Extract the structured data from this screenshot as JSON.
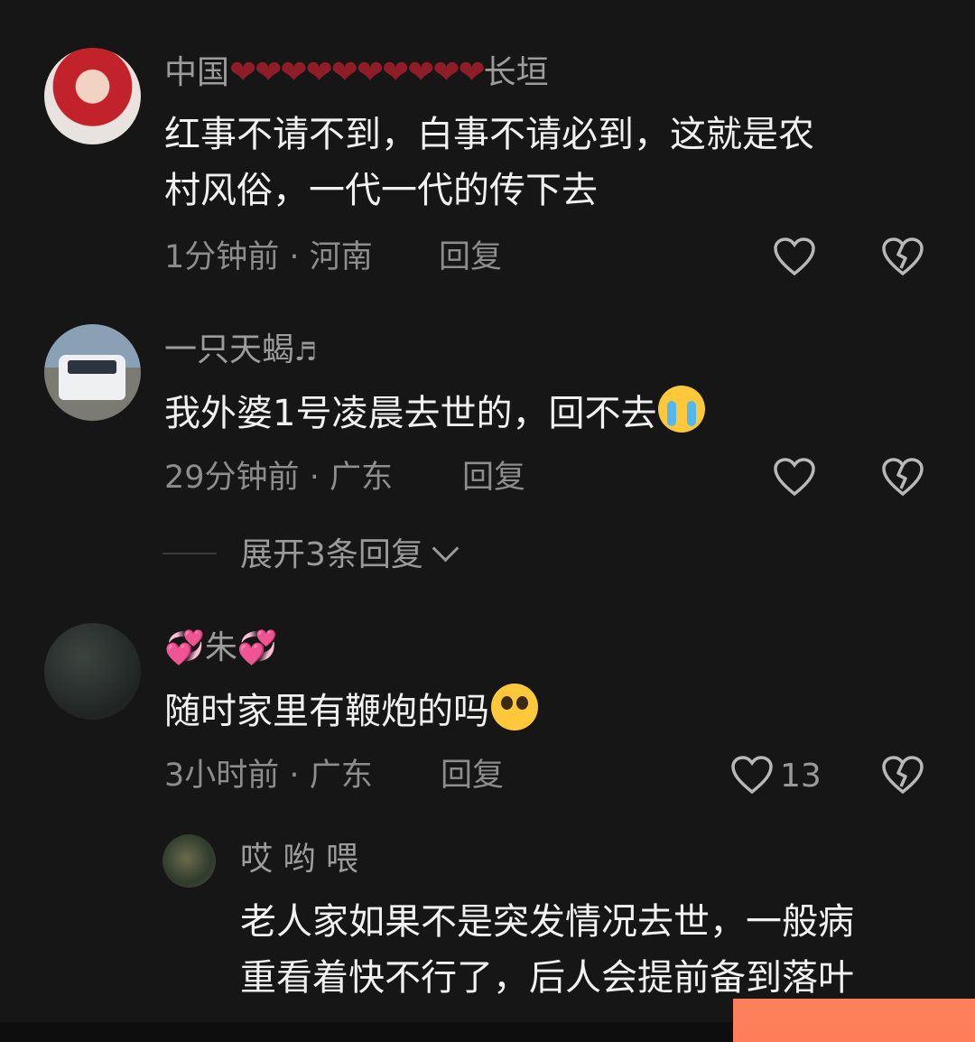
{
  "comments": [
    {
      "name_prefix": "中国",
      "name_hearts": "❤❤❤❤❤❤❤❤❤❤",
      "name_suffix": "长垣",
      "text_line1": "红事不请不到，白事不请必到，这就是农",
      "text_line2": "村风俗，一代一代的传下去",
      "time": "1分钟前",
      "location": "河南",
      "reply_label": "回复"
    },
    {
      "name": "一只天蝎",
      "name_note": "♬",
      "text": "我外婆1号凌晨去世的，回不去",
      "emoji": "loudly-crying-face",
      "time": "29分钟前",
      "location": "广东",
      "reply_label": "回复",
      "expand_label": "展开3条回复"
    },
    {
      "name_left": "💞",
      "name": "朱",
      "name_right": "💞",
      "text": "随时家里有鞭炮的吗",
      "emoji": "pleading-face",
      "time": "3小时前",
      "location": "广东",
      "reply_label": "回复",
      "like_count": "13"
    }
  ],
  "sub_reply": {
    "name": "哎 哟 喂",
    "text_line1": "老人家如果不是突发情况去世，一般病",
    "text_line2": "重看着快不行了，后人会提前备到落叶"
  },
  "meta_separator": "·",
  "colors": {
    "background": "#161616",
    "accent": "#ff7f5a",
    "heart_red": "#8e1d28"
  },
  "icons": [
    "heart-outline-icon",
    "broken-heart-icon",
    "chevron-down-icon"
  ]
}
